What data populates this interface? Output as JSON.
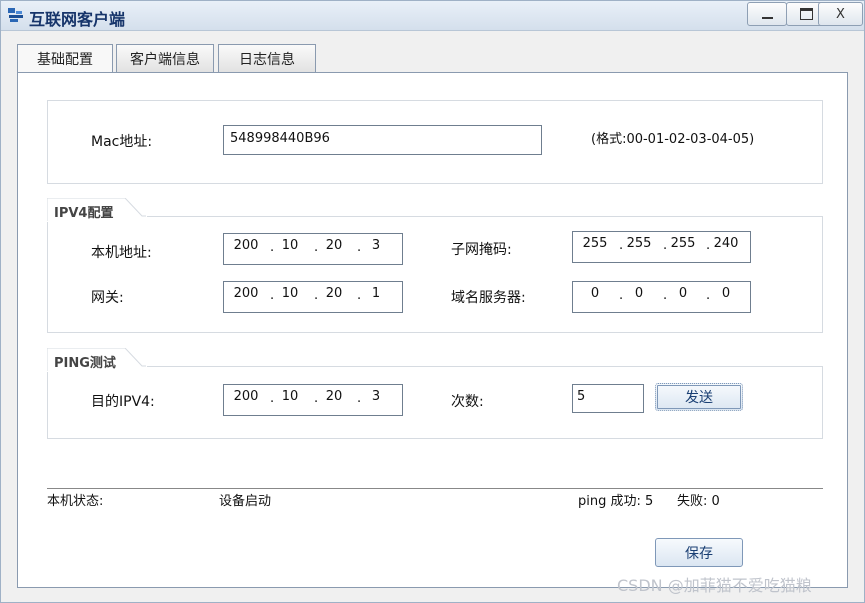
{
  "window": {
    "title": "互联网客户端",
    "controls": {
      "minimize": "−",
      "maximize": "□",
      "close": "X"
    }
  },
  "tabs": [
    {
      "label": "基础配置",
      "active": true
    },
    {
      "label": "客户端信息",
      "active": false
    },
    {
      "label": "日志信息",
      "active": false
    }
  ],
  "mac": {
    "label": "Mac地址:",
    "value": "548998440B96",
    "hint": "(格式:00-01-02-03-04-05)"
  },
  "ipv4": {
    "title": "IPV4配置",
    "local_ip": {
      "label": "本机地址:",
      "octets": [
        "200",
        "10",
        "20",
        "3"
      ]
    },
    "subnet_mask": {
      "label": "子网掩码:",
      "octets": [
        "255",
        "255",
        "255",
        "240"
      ]
    },
    "gateway": {
      "label": "网关:",
      "octets": [
        "200",
        "10",
        "20",
        "1"
      ]
    },
    "dns": {
      "label": "域名服务器:",
      "octets": [
        "0",
        "0",
        "0",
        "0"
      ]
    }
  },
  "ping": {
    "title": "PING测试",
    "target": {
      "label": "目的IPV4:",
      "octets": [
        "200",
        "10",
        "20",
        "3"
      ]
    },
    "count": {
      "label": "次数:",
      "value": "5"
    },
    "send_label": "发送"
  },
  "status": {
    "label": "本机状态:",
    "value": "设备启动",
    "ping_success": "ping 成功: 5",
    "ping_fail": "失败: 0"
  },
  "save_label": "保存",
  "watermark": "CSDN @加菲猫不爱吃猫粮"
}
